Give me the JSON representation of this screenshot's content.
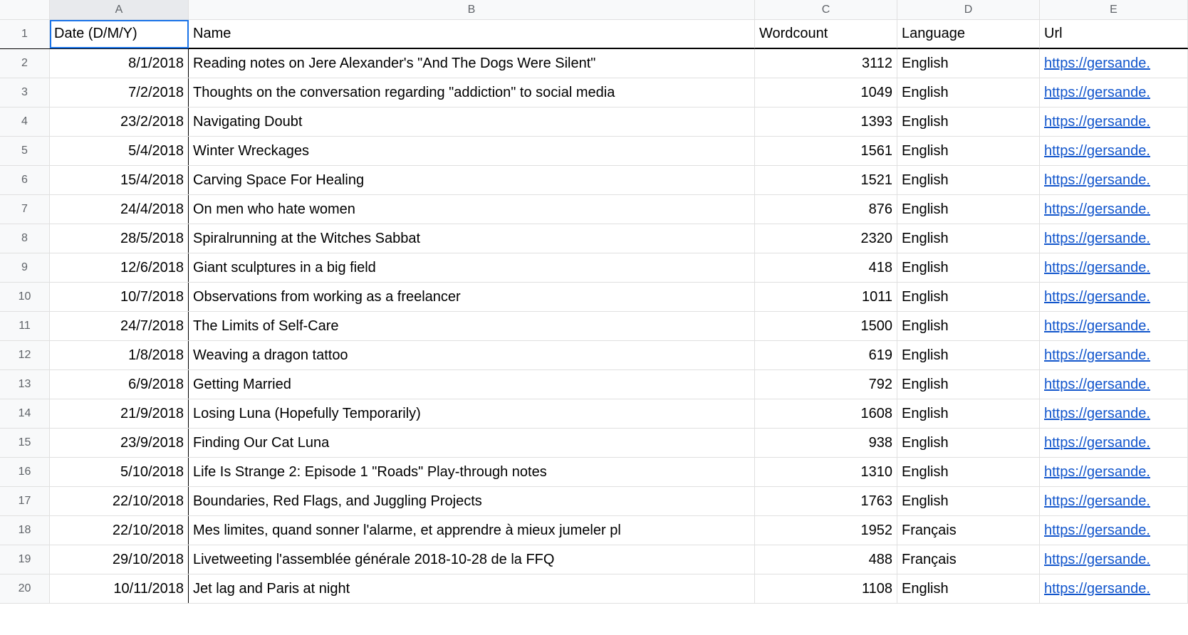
{
  "columns": [
    "A",
    "B",
    "C",
    "D",
    "E"
  ],
  "headers": {
    "date": "Date (D/M/Y)",
    "name": "Name",
    "wordcount": "Wordcount",
    "language": "Language",
    "url": "Url"
  },
  "rows": [
    {
      "rownum": "1"
    },
    {
      "rownum": "2",
      "date": "8/1/2018",
      "name": "Reading notes on Jere Alexander's \"And The Dogs Were Silent\"",
      "wordcount": "3112",
      "language": "English",
      "url": "https://gersande."
    },
    {
      "rownum": "3",
      "date": "7/2/2018",
      "name": "Thoughts on the conversation regarding \"addiction\" to social media",
      "wordcount": "1049",
      "language": "English",
      "url": "https://gersande."
    },
    {
      "rownum": "4",
      "date": "23/2/2018",
      "name": "Navigating Doubt",
      "wordcount": "1393",
      "language": "English",
      "url": "https://gersande."
    },
    {
      "rownum": "5",
      "date": "5/4/2018",
      "name": "Winter Wreckages",
      "wordcount": "1561",
      "language": "English",
      "url": "https://gersande."
    },
    {
      "rownum": "6",
      "date": "15/4/2018",
      "name": "Carving Space For Healing",
      "wordcount": "1521",
      "language": "English",
      "url": "https://gersande."
    },
    {
      "rownum": "7",
      "date": "24/4/2018",
      "name": "On men who hate women",
      "wordcount": "876",
      "language": "English",
      "url": "https://gersande."
    },
    {
      "rownum": "8",
      "date": "28/5/2018",
      "name": "Spiralrunning at the Witches Sabbat",
      "wordcount": "2320",
      "language": "English",
      "url": "https://gersande."
    },
    {
      "rownum": "9",
      "date": "12/6/2018",
      "name": "Giant sculptures in a big field",
      "wordcount": "418",
      "language": "English",
      "url": "https://gersande."
    },
    {
      "rownum": "10",
      "date": "10/7/2018",
      "name": "Observations from working as a freelancer",
      "wordcount": "1011",
      "language": "English",
      "url": "https://gersande."
    },
    {
      "rownum": "11",
      "date": "24/7/2018",
      "name": "The Limits of Self-Care",
      "wordcount": "1500",
      "language": "English",
      "url": "https://gersande."
    },
    {
      "rownum": "12",
      "date": "1/8/2018",
      "name": "Weaving a dragon tattoo",
      "wordcount": "619",
      "language": "English",
      "url": "https://gersande."
    },
    {
      "rownum": "13",
      "date": "6/9/2018",
      "name": "Getting Married",
      "wordcount": "792",
      "language": "English",
      "url": "https://gersande."
    },
    {
      "rownum": "14",
      "date": "21/9/2018",
      "name": "Losing Luna (Hopefully Temporarily)",
      "wordcount": "1608",
      "language": "English",
      "url": "https://gersande."
    },
    {
      "rownum": "15",
      "date": "23/9/2018",
      "name": "Finding Our Cat Luna",
      "wordcount": "938",
      "language": "English",
      "url": "https://gersande."
    },
    {
      "rownum": "16",
      "date": "5/10/2018",
      "name": "Life Is Strange 2: Episode 1 \"Roads\" Play-through notes",
      "wordcount": "1310",
      "language": "English",
      "url": "https://gersande."
    },
    {
      "rownum": "17",
      "date": "22/10/2018",
      "name": "Boundaries, Red Flags, and Juggling Projects",
      "wordcount": "1763",
      "language": "English",
      "url": "https://gersande."
    },
    {
      "rownum": "18",
      "date": "22/10/2018",
      "name": "Mes limites, quand sonner l'alarme, et apprendre à mieux jumeler pl",
      "wordcount": "1952",
      "language": "Français",
      "url": "https://gersande."
    },
    {
      "rownum": "19",
      "date": "29/10/2018",
      "name": "Livetweeting l'assemblée générale 2018-10-28 de la FFQ",
      "wordcount": "488",
      "language": "Français",
      "url": "https://gersande."
    },
    {
      "rownum": "20",
      "date": "10/11/2018",
      "name": "Jet lag and Paris at night",
      "wordcount": "1108",
      "language": "English",
      "url": "https://gersande."
    }
  ]
}
